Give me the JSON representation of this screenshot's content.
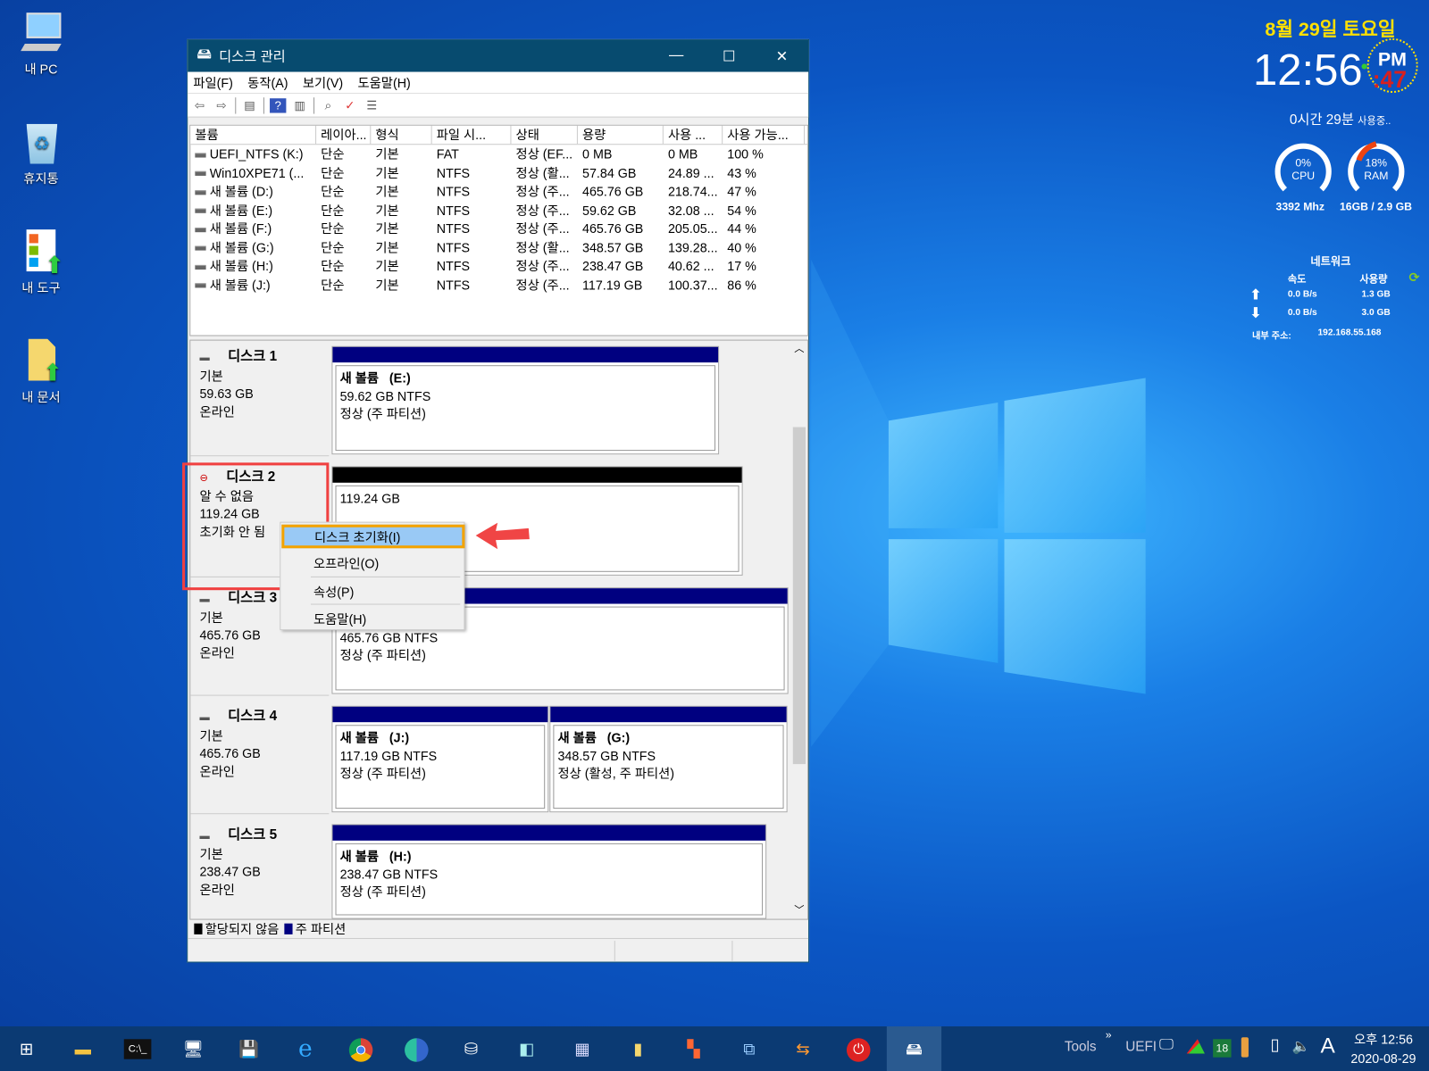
{
  "desktop": {
    "icons": [
      {
        "label": "내 PC",
        "icon": "computer-icon"
      },
      {
        "label": "휴지통",
        "icon": "recycle-bin-icon"
      },
      {
        "label": "내 도구",
        "icon": "tools-shortcut-icon"
      },
      {
        "label": "내 문서",
        "icon": "documents-shortcut-icon"
      }
    ]
  },
  "widget": {
    "date": "8월 29일 토요일",
    "time": "12:56",
    "ampm": "PM",
    "seconds": ":47",
    "uptime": "0시간 29분",
    "uptime_suffix": "사용중..",
    "cpu": {
      "percent": "0%",
      "label": "CPU",
      "value": 0,
      "freq": "3392 Mhz"
    },
    "ram": {
      "percent": "18%",
      "label": "RAM",
      "value": 18,
      "size": "16GB / 2.9 GB"
    },
    "network": {
      "title": "네트워크",
      "speed_header": "속도",
      "usage_header": "사용량",
      "up_speed": "0.0 B/s",
      "up_usage": "1.3 GB",
      "down_speed": "0.0 B/s",
      "down_usage": "3.0 GB",
      "ip_label": "내부 주소:",
      "ip": "192.168.55.168"
    }
  },
  "window": {
    "title": "디스크 관리",
    "menu": [
      "파일(F)",
      "동작(A)",
      "보기(V)",
      "도움말(H)"
    ],
    "columns": [
      "볼륨",
      "레이아...",
      "형식",
      "파일 시...",
      "상태",
      "용량",
      "사용 ...",
      "사용 가능..."
    ],
    "volumes": [
      [
        "UEFI_NTFS (K:)",
        "단순",
        "기본",
        "FAT",
        "정상 (EF...",
        "0 MB",
        "0 MB",
        "100 %"
      ],
      [
        "Win10XPE71 (...",
        "단순",
        "기본",
        "NTFS",
        "정상 (활...",
        "57.84 GB",
        "24.89 ...",
        "43 %"
      ],
      [
        "새 볼륨 (D:)",
        "단순",
        "기본",
        "NTFS",
        "정상 (주...",
        "465.76 GB",
        "218.74...",
        "47 %"
      ],
      [
        "새 볼륨 (E:)",
        "단순",
        "기본",
        "NTFS",
        "정상 (주...",
        "59.62 GB",
        "32.08 ...",
        "54 %"
      ],
      [
        "새 볼륨 (F:)",
        "단순",
        "기본",
        "NTFS",
        "정상 (주...",
        "465.76 GB",
        "205.05...",
        "44 %"
      ],
      [
        "새 볼륨 (G:)",
        "단순",
        "기본",
        "NTFS",
        "정상 (활...",
        "348.57 GB",
        "139.28...",
        "40 %"
      ],
      [
        "새 볼륨 (H:)",
        "단순",
        "기본",
        "NTFS",
        "정상 (주...",
        "238.47 GB",
        "40.62 ...",
        "17 %"
      ],
      [
        "새 볼륨 (J:)",
        "단순",
        "기본",
        "NTFS",
        "정상 (주...",
        "117.19 GB",
        "100.37...",
        "86 %"
      ]
    ],
    "disks": [
      {
        "name": "디스크 1",
        "type": "기본",
        "size": "59.63 GB",
        "state": "온라인",
        "parts": [
          {
            "name": "새 볼륨   (E:)",
            "size": "59.62 GB NTFS",
            "status": "정상 (주 파티션)"
          }
        ]
      },
      {
        "name": "디스크 2",
        "type": "알 수 없음",
        "size": "119.24 GB",
        "state": "초기화 안 됨",
        "parts": [
          {
            "name": "",
            "size": "119.24 GB",
            "status": ""
          }
        ]
      },
      {
        "name": "디스크 3",
        "type": "기본",
        "size": "465.76 GB",
        "state": "온라인",
        "parts": [
          {
            "name": "새 볼륨   (D:)",
            "size": "465.76 GB NTFS",
            "status": "정상 (주 파티션)"
          }
        ]
      },
      {
        "name": "디스크 4",
        "type": "기본",
        "size": "465.76 GB",
        "state": "온라인",
        "parts": [
          {
            "name": "새 볼륨   (J:)",
            "size": "117.19 GB NTFS",
            "status": "정상 (주 파티션)"
          },
          {
            "name": "새 볼륨   (G:)",
            "size": "348.57 GB NTFS",
            "status": "정상 (활성, 주 파티션)"
          }
        ]
      },
      {
        "name": "디스크 5",
        "type": "기본",
        "size": "238.47 GB",
        "state": "온라인",
        "parts": [
          {
            "name": "새 볼륨   (H:)",
            "size": "238.47 GB NTFS",
            "status": "정상 (주 파티션)"
          }
        ]
      }
    ],
    "legend": [
      "할당되지 않음",
      "주 파티션"
    ],
    "context_menu": [
      "디스크 초기화(I)",
      "오프라인(O)",
      "속성(P)",
      "도움말(H)"
    ]
  },
  "colors": {
    "primary_partition": "#000080",
    "unallocated": "#000000",
    "highlight_border": "#f4a300",
    "annotation": "#f04040",
    "titlebar": "#074b6f"
  },
  "taskbar": {
    "tools_label": "Tools",
    "uefi_label": "UEFI",
    "badge": "18",
    "ime": "A",
    "time": "오후 12:56",
    "date": "2020-08-29"
  }
}
